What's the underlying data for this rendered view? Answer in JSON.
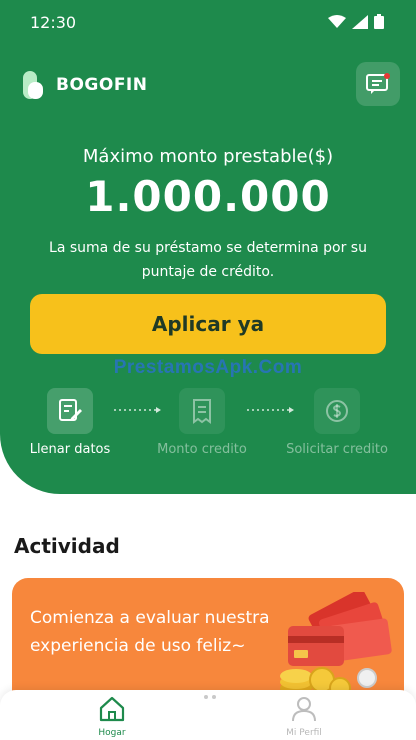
{
  "status_bar": {
    "time": "12:30"
  },
  "header": {
    "brand": "BOGOFIN",
    "messages_icon": "message-icon"
  },
  "hero": {
    "max_label": "Máximo monto prestable($)",
    "amount": "1.000.000",
    "description": "La suma de su préstamo se determina por su puntaje de crédito.",
    "apply_label": "Aplicar ya",
    "watermark": "PrestamosApk.Com"
  },
  "steps": [
    {
      "label": "Llenar datos",
      "icon": "edit-form-icon",
      "active": true
    },
    {
      "label": "Monto credito",
      "icon": "receipt-icon",
      "active": false
    },
    {
      "label": "Solicitar credito",
      "icon": "coin-icon",
      "active": false
    }
  ],
  "activity": {
    "title": "Actividad",
    "banner_text": "Comienza a evaluar nuestra experiencia de uso feliz~"
  },
  "bottom_nav": [
    {
      "label": "Hogar",
      "icon": "home-icon",
      "active": true
    },
    {
      "label": "Mi Perfil",
      "icon": "user-icon",
      "active": false
    }
  ],
  "colors": {
    "primary_green": "#1e8a4c",
    "accent_yellow": "#f7c11b",
    "banner_orange": "#f7873c"
  }
}
